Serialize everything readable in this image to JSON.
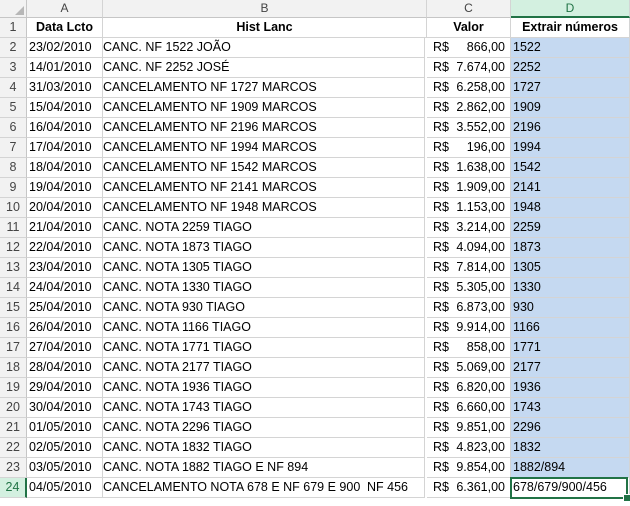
{
  "columns": [
    "A",
    "B",
    "C",
    "D"
  ],
  "headers": {
    "date": "Data Lcto",
    "hist": "Hist Lanc",
    "valor": "Valor",
    "extract": "Extrair números"
  },
  "currency_symbol": "R$",
  "selected_column": "D",
  "active_row": "24",
  "colors": {
    "selection_fill": "#c5d9f1",
    "active_border": "#217346"
  },
  "rows": [
    {
      "num": "1"
    },
    {
      "num": "2",
      "date": "23/02/2010",
      "hist": "CANC. NF 1522 JOÃO",
      "valor": "866,00",
      "extract": "1522"
    },
    {
      "num": "3",
      "date": "14/01/2010",
      "hist": "CANC. NF 2252 JOSÉ",
      "valor": "7.674,00",
      "extract": "2252"
    },
    {
      "num": "4",
      "date": "31/03/2010",
      "hist": "CANCELAMENTO NF 1727 MARCOS",
      "valor": "6.258,00",
      "extract": "1727"
    },
    {
      "num": "5",
      "date": "15/04/2010",
      "hist": "CANCELAMENTO NF 1909 MARCOS",
      "valor": "2.862,00",
      "extract": "1909"
    },
    {
      "num": "6",
      "date": "16/04/2010",
      "hist": "CANCELAMENTO NF 2196 MARCOS",
      "valor": "3.552,00",
      "extract": "2196"
    },
    {
      "num": "7",
      "date": "17/04/2010",
      "hist": "CANCELAMENTO NF 1994 MARCOS",
      "valor": "196,00",
      "extract": "1994"
    },
    {
      "num": "8",
      "date": "18/04/2010",
      "hist": "CANCELAMENTO NF 1542 MARCOS",
      "valor": "1.638,00",
      "extract": "1542"
    },
    {
      "num": "9",
      "date": "19/04/2010",
      "hist": "CANCELAMENTO NF 2141 MARCOS",
      "valor": "1.909,00",
      "extract": "2141"
    },
    {
      "num": "10",
      "date": "20/04/2010",
      "hist": "CANCELAMENTO NF 1948 MARCOS",
      "valor": "1.153,00",
      "extract": "1948"
    },
    {
      "num": "11",
      "date": "21/04/2010",
      "hist": "CANC. NOTA 2259 TIAGO",
      "valor": "3.214,00",
      "extract": "2259"
    },
    {
      "num": "12",
      "date": "22/04/2010",
      "hist": "CANC. NOTA 1873 TIAGO",
      "valor": "4.094,00",
      "extract": "1873"
    },
    {
      "num": "13",
      "date": "23/04/2010",
      "hist": "CANC. NOTA 1305 TIAGO",
      "valor": "7.814,00",
      "extract": "1305"
    },
    {
      "num": "14",
      "date": "24/04/2010",
      "hist": "CANC. NOTA 1330 TIAGO",
      "valor": "5.305,00",
      "extract": "1330"
    },
    {
      "num": "15",
      "date": "25/04/2010",
      "hist": "CANC. NOTA 930 TIAGO",
      "valor": "6.873,00",
      "extract": "930"
    },
    {
      "num": "16",
      "date": "26/04/2010",
      "hist": "CANC. NOTA 1166 TIAGO",
      "valor": "9.914,00",
      "extract": "1166"
    },
    {
      "num": "17",
      "date": "27/04/2010",
      "hist": "CANC. NOTA 1771 TIAGO",
      "valor": "858,00",
      "extract": "1771"
    },
    {
      "num": "18",
      "date": "28/04/2010",
      "hist": "CANC. NOTA 2177 TIAGO",
      "valor": "5.069,00",
      "extract": "2177"
    },
    {
      "num": "19",
      "date": "29/04/2010",
      "hist": "CANC. NOTA 1936 TIAGO",
      "valor": "6.820,00",
      "extract": "1936"
    },
    {
      "num": "20",
      "date": "30/04/2010",
      "hist": "CANC. NOTA 1743 TIAGO",
      "valor": "6.660,00",
      "extract": "1743"
    },
    {
      "num": "21",
      "date": "01/05/2010",
      "hist": "CANC. NOTA 2296 TIAGO",
      "valor": "9.851,00",
      "extract": "2296"
    },
    {
      "num": "22",
      "date": "02/05/2010",
      "hist": "CANC. NOTA 1832 TIAGO",
      "valor": "4.823,00",
      "extract": "1832"
    },
    {
      "num": "23",
      "date": "03/05/2010",
      "hist": "CANC. NOTA 1882 TIAGO E NF 894",
      "valor": "9.854,00",
      "extract": "1882/894"
    },
    {
      "num": "24",
      "date": "04/05/2010",
      "hist": "CANCELAMENTO NOTA 678 E NF 679 E 900",
      "hist_extra": "NF  456",
      "valor": "6.361,00",
      "extract": "678/679/900/456"
    }
  ]
}
